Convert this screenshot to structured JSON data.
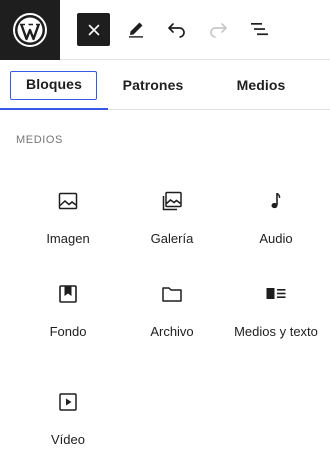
{
  "toolbar": {
    "logo_icon": "wordpress-logo-icon",
    "close_icon": "close-icon",
    "edit_icon": "pencil-icon",
    "undo_icon": "undo-icon",
    "redo_icon": "redo-icon",
    "outline_icon": "list-view-icon"
  },
  "tabs": {
    "blocks": "Bloques",
    "patterns": "Patrones",
    "media": "Medios"
  },
  "section": {
    "title": "MEDIOS"
  },
  "blocks": {
    "image": "Imagen",
    "gallery": "Galería",
    "audio": "Audio",
    "cover": "Fondo",
    "file": "Archivo",
    "media_text": "Medios y texto",
    "video": "Vídeo"
  },
  "colors": {
    "accent": "#3858e9",
    "dark": "#1e1e1e",
    "muted": "#757575"
  }
}
